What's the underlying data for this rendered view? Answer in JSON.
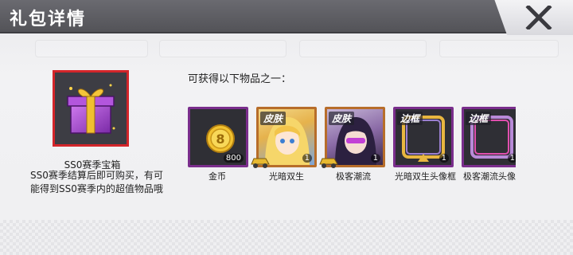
{
  "window": {
    "title": "礼包详情"
  },
  "chest": {
    "name": "SS0赛季宝箱",
    "description": "SS0赛季结算后即可购买，有可能得到SS0赛季内的超值物品哦"
  },
  "items_header": "可获得以下物品之一：",
  "items": [
    {
      "name": "金币",
      "count": "800",
      "badge": "",
      "type": "coin",
      "frame_color": "#7a2e8c"
    },
    {
      "name": "光暗双生",
      "count": "1",
      "badge": "皮肤",
      "type": "skin",
      "frame_color": "#b76d2a"
    },
    {
      "name": "极客潮流",
      "count": "1",
      "badge": "皮肤",
      "type": "skin",
      "frame_color": "#b76d2a"
    },
    {
      "name": "光暗双生头像框",
      "count": "1",
      "badge": "边框",
      "type": "frame",
      "frame_color": "#7a2e8c"
    },
    {
      "name": "极客潮流头像框",
      "count": "1",
      "badge": "边框",
      "type": "frame",
      "frame_color": "#7a2e8c"
    }
  ],
  "colors": {
    "title_bar": "#5f5f65",
    "chest_border": "#d3252a",
    "purple_frame": "#7a2e8c",
    "orange_frame": "#b76d2a"
  }
}
